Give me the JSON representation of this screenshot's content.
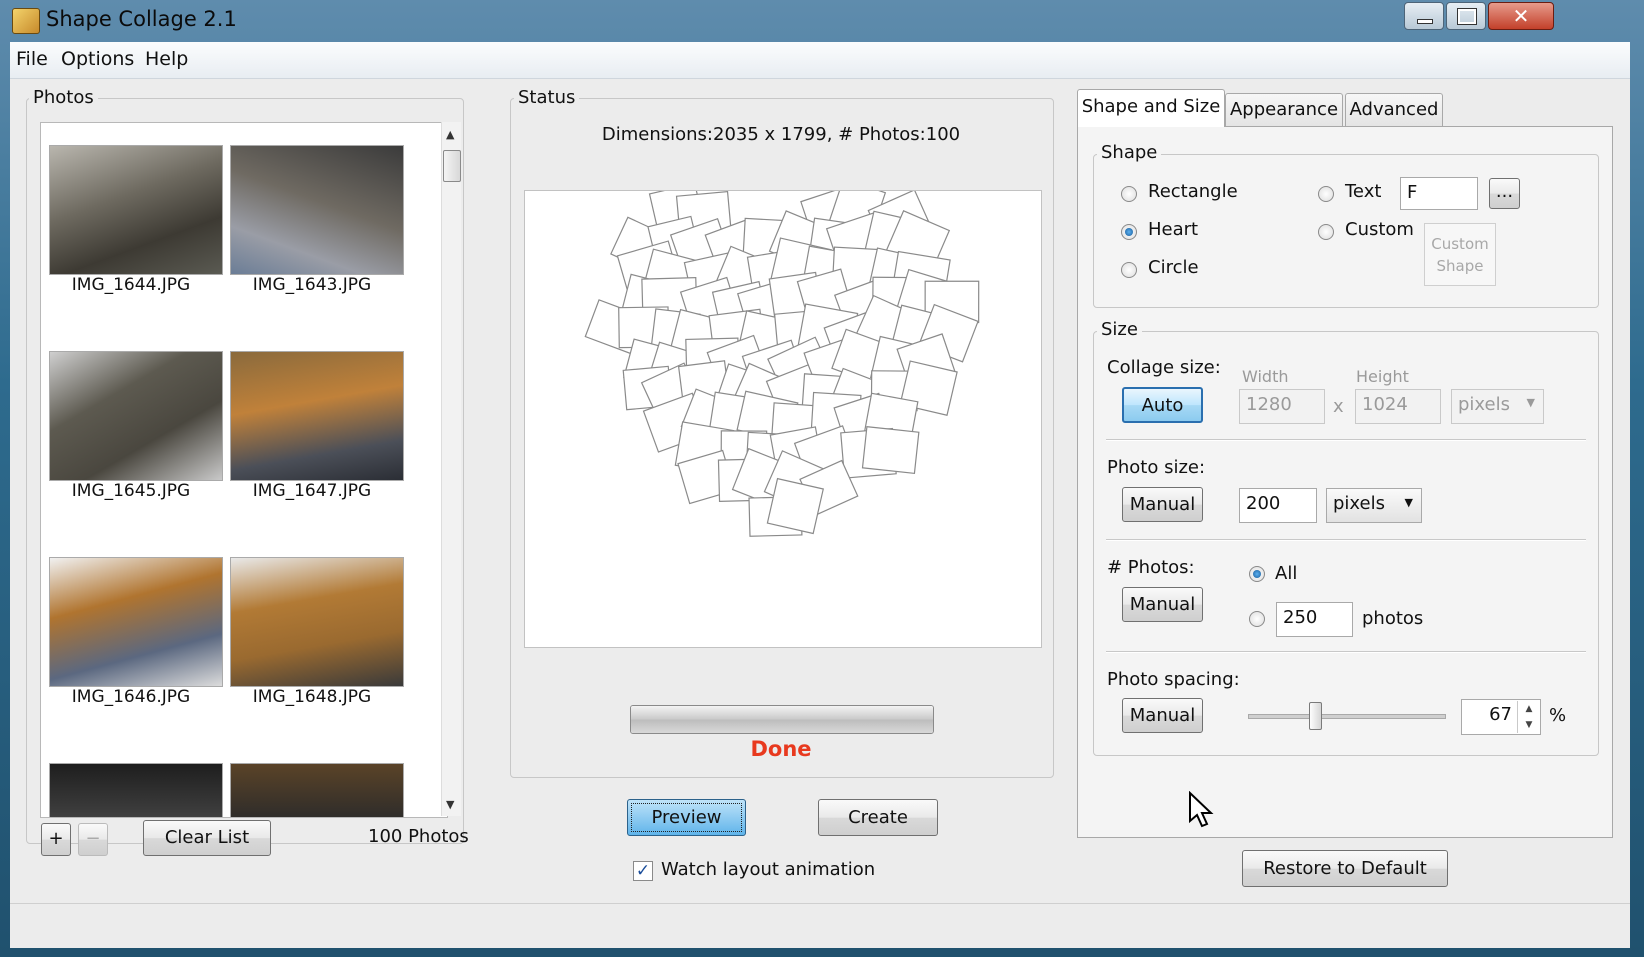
{
  "window": {
    "title": "Shape Collage 2.1"
  },
  "menu": {
    "file": "File",
    "options": "Options",
    "help": "Help"
  },
  "photos": {
    "legend": "Photos",
    "items": [
      {
        "name": "IMG_1644.JPG"
      },
      {
        "name": "IMG_1643.JPG"
      },
      {
        "name": "IMG_1645.JPG"
      },
      {
        "name": "IMG_1647.JPG"
      },
      {
        "name": "IMG_1646.JPG"
      },
      {
        "name": "IMG_1648.JPG"
      }
    ],
    "add_label": "+",
    "remove_label": "−",
    "clear_label": "Clear List",
    "count_text": "100 Photos"
  },
  "status": {
    "legend": "Status",
    "info": "Dimensions:2035 x 1799, # Photos:100",
    "progress_fraction": 1.0,
    "progress_text": "Done",
    "progress_text_color": "#e8391e"
  },
  "actions": {
    "preview_label": "Preview",
    "create_label": "Create",
    "watch_label": "Watch layout animation",
    "watch_checked": true
  },
  "tabs": {
    "items": [
      "Shape and Size",
      "Appearance",
      "Advanced"
    ],
    "active": "Shape and Size"
  },
  "shape": {
    "legend": "Shape",
    "rectangle_label": "Rectangle",
    "heart_label": "Heart",
    "circle_label": "Circle",
    "text_label": "Text",
    "custom_label": "Custom",
    "text_value": "F",
    "ellipsis_label": "...",
    "custom_shape_line1": "Custom",
    "custom_shape_line2": "Shape",
    "selected": "Heart"
  },
  "size": {
    "legend": "Size",
    "collage_size_label": "Collage size:",
    "auto_label": "Auto",
    "width_label": "Width",
    "height_label": "Height",
    "width_value": "1280",
    "height_value": "1024",
    "times_label": "x",
    "units_value": "pixels",
    "photo_size_label": "Photo size:",
    "photo_size_manual_label": "Manual",
    "photo_size_value": "200",
    "photo_size_units": "pixels",
    "num_photos_label": "# Photos:",
    "num_photos_manual_label": "Manual",
    "all_label": "All",
    "photos_value": "250",
    "photos_units": "photos",
    "spacing_label": "Photo spacing:",
    "spacing_manual_label": "Manual",
    "spacing_value": "67",
    "spacing_percent": "%",
    "spacing_slider_fraction": 0.33
  },
  "restore_label": "Restore to Default",
  "colors": {
    "done": "#e8391e",
    "accent": "#3c7fb1"
  }
}
